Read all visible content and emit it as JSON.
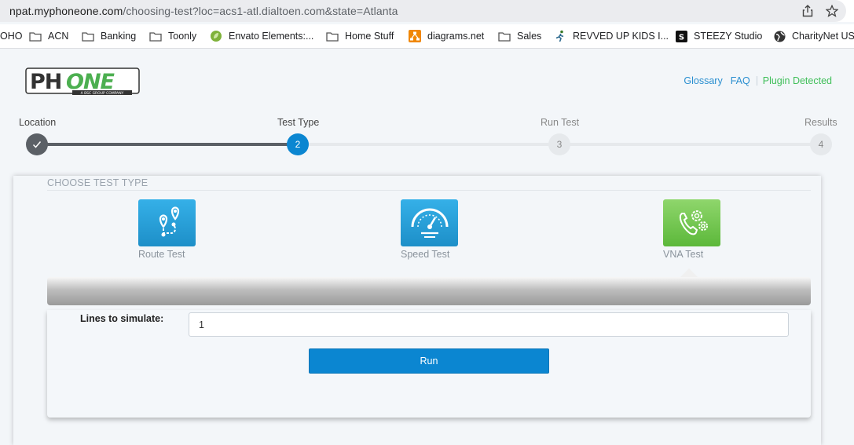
{
  "browser": {
    "url_host": "npat.myphoneone.com",
    "url_path": "/choosing-test?loc=acs1-atl.dialtoen.com&state=Atlanta",
    "share_icon": "share-icon",
    "star_icon": "star-icon",
    "bookmarks": [
      {
        "label": "OHO",
        "icon": "none"
      },
      {
        "label": "ACN",
        "icon": "folder-icon"
      },
      {
        "label": "Banking",
        "icon": "folder-icon"
      },
      {
        "label": "Toonly",
        "icon": "folder-icon"
      },
      {
        "label": "Envato Elements:...",
        "icon": "envato-leaf-icon"
      },
      {
        "label": "Home Stuff",
        "icon": "folder-icon"
      },
      {
        "label": "diagrams.net",
        "icon": "diagrams-icon"
      },
      {
        "label": "Sales",
        "icon": "folder-icon"
      },
      {
        "label": "REVVED UP KIDS I...",
        "icon": "runner-icon"
      },
      {
        "label": "STEEZY Studio",
        "icon": "steezy-icon"
      },
      {
        "label": "CharityNet US",
        "icon": "globe-icon"
      }
    ]
  },
  "header": {
    "logo_text_ph": "PH",
    "logo_text_one": "ONE",
    "logo_tagline": "A BSC GROUP COMPANY",
    "links": {
      "glossary": "Glossary",
      "faq": "FAQ",
      "plugin": "Plugin Detected"
    }
  },
  "stepper": {
    "steps": [
      {
        "label": "Location",
        "marker": "✓",
        "state": "done"
      },
      {
        "label": "Test Type",
        "marker": "2",
        "state": "active"
      },
      {
        "label": "Run Test",
        "marker": "3",
        "state": "pending"
      },
      {
        "label": "Results",
        "marker": "4",
        "state": "pending"
      }
    ]
  },
  "main": {
    "section_title": "CHOOSE TEST TYPE",
    "tests": [
      {
        "label": "Route Test",
        "icon": "route-pins-icon",
        "selected": false
      },
      {
        "label": "Speed Test",
        "icon": "speedometer-icon",
        "selected": false
      },
      {
        "label": "VNA Test",
        "icon": "phone-gears-icon",
        "selected": true
      }
    ],
    "lines_label": "Lines to simulate:",
    "lines_value": "1",
    "run_label": "Run"
  },
  "colors": {
    "accent_blue": "#0b86d1",
    "done_gray": "#5b6066",
    "plugin_green": "#3fbf59",
    "logo_green": "#4caf50"
  }
}
